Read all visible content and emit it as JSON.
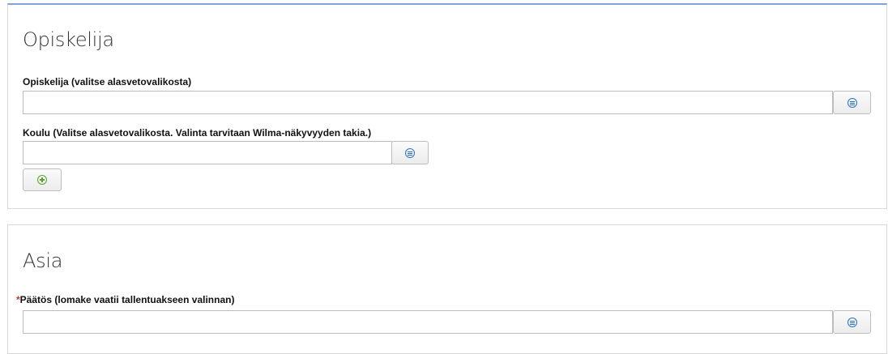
{
  "student_section": {
    "title": "Opiskelija",
    "student_field": {
      "label": "Opiskelija (valitse alasvetovalikosta)",
      "value": ""
    },
    "school_field": {
      "label": "Koulu (Valitse alasvetovalikosta. Valinta tarvitaan Wilma-näkyvyyden takia.)",
      "value": ""
    }
  },
  "matter_section": {
    "title": "Asia",
    "decision_field": {
      "required_mark": "*",
      "label": "Päätös (lomake vaatii tallentuakseen valinnan)",
      "value": ""
    }
  },
  "icons": {
    "list": "list-select-icon",
    "add": "add-circle-icon"
  },
  "colors": {
    "list_icon": "#2a6fbf",
    "add_icon": "#5aa02c",
    "required": "#c0392b",
    "panel_top_border": "#7fa7d6"
  }
}
